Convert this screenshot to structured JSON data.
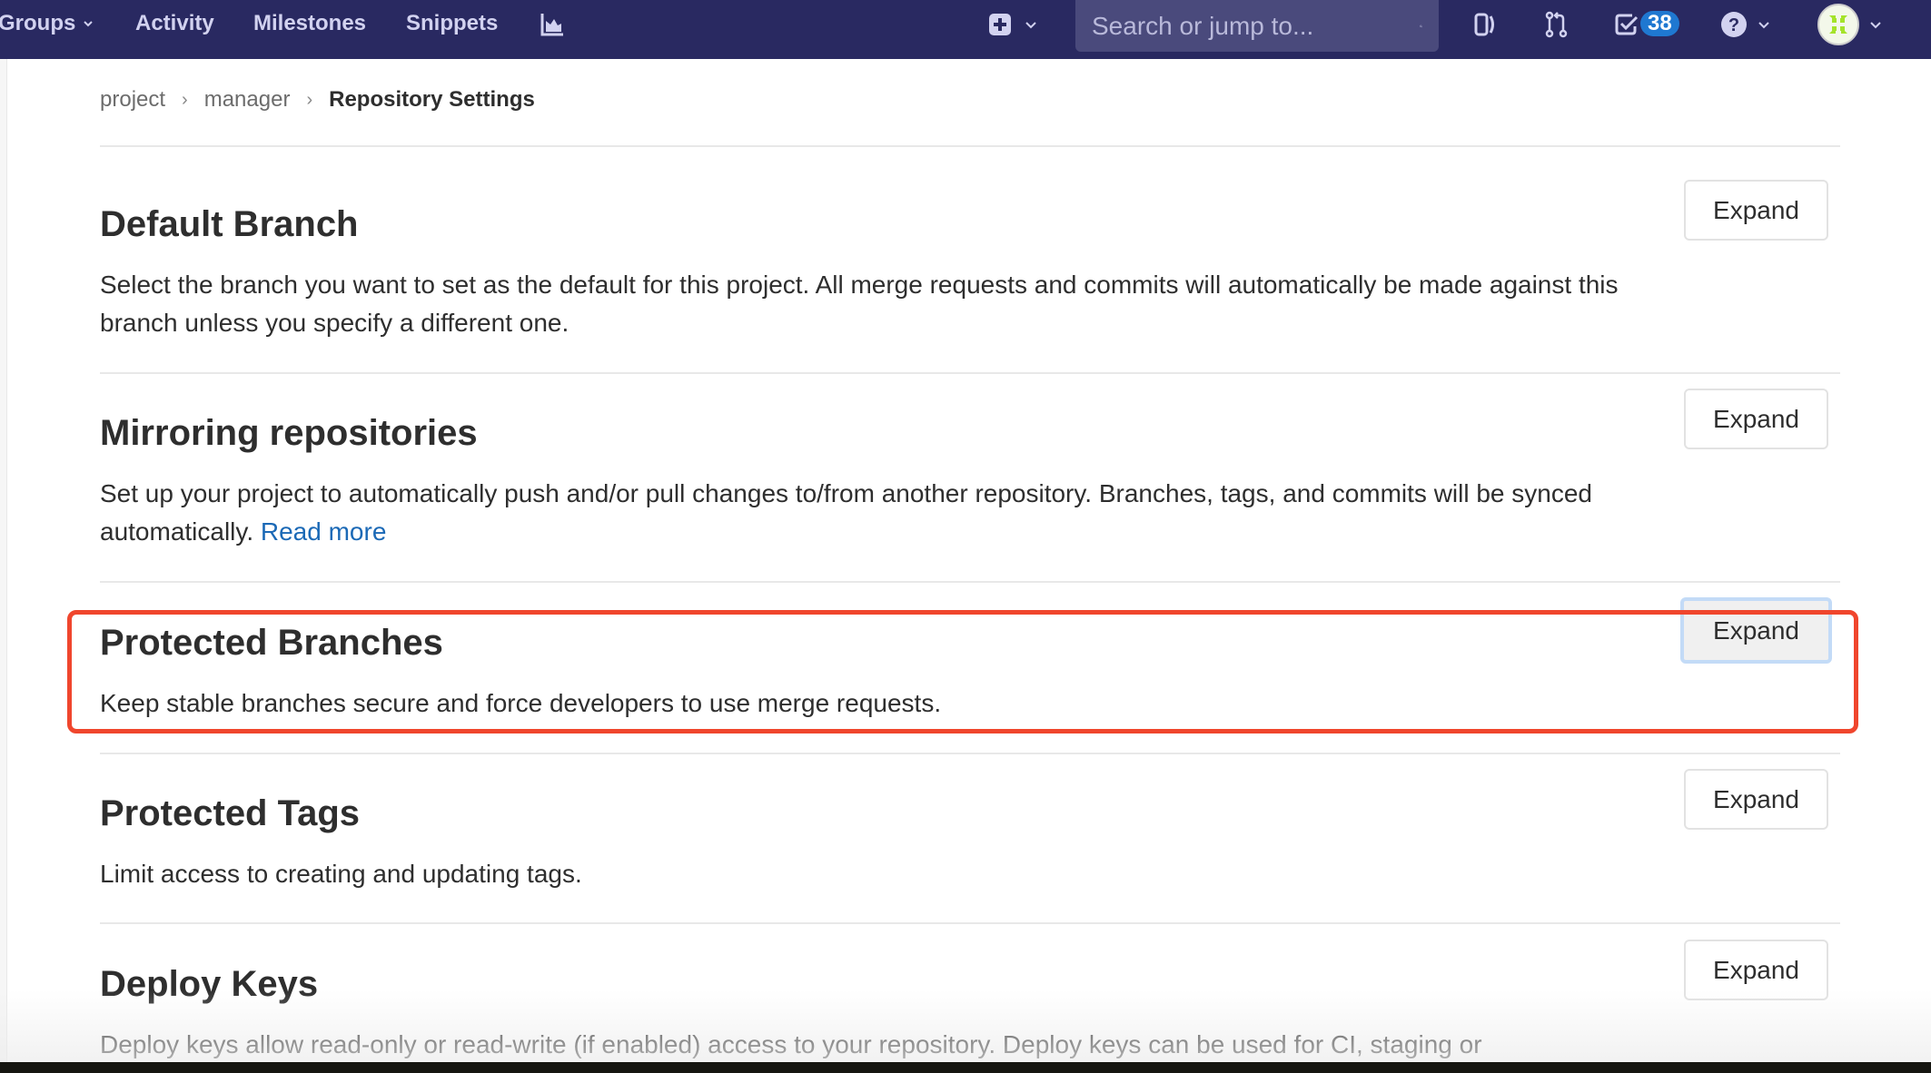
{
  "navbar": {
    "links": [
      {
        "label": "Groups",
        "has_dropdown": true
      },
      {
        "label": "Activity"
      },
      {
        "label": "Milestones"
      },
      {
        "label": "Snippets"
      }
    ],
    "chart_icon": "chart-icon",
    "new_icon": "plus-square-icon",
    "search": {
      "placeholder": "Search or jump to...",
      "value": ""
    },
    "issues_icon": "issues-icon",
    "merge_requests_icon": "merge-request-icon",
    "todos": {
      "icon": "todo-check-icon",
      "count": "38"
    },
    "help_icon": "help-icon",
    "avatar_icon": "user-avatar"
  },
  "breadcrumb": {
    "items": [
      "project",
      "manager"
    ],
    "current": "Repository Settings",
    "separator": "›"
  },
  "sections": [
    {
      "title": "Default Branch",
      "description": "Select the branch you want to set as the default for this project. All merge requests and commits will automatically be made against this branch unless you specify a different one.",
      "button": "Expand"
    },
    {
      "title": "Mirroring repositories",
      "description": "Set up your project to automatically push and/or pull changes to/from another repository. Branches, tags, and commits will be synced automatically.",
      "link": "Read more",
      "button": "Expand"
    },
    {
      "title": "Protected Branches",
      "description": "Keep stable branches secure and force developers to use merge requests.",
      "button": "Expand",
      "highlighted": true,
      "highlight_color": "#f0462d"
    },
    {
      "title": "Protected Tags",
      "description": "Limit access to creating and updating tags.",
      "button": "Expand"
    },
    {
      "title": "Deploy Keys",
      "description": "Deploy keys allow read-only or read-write (if enabled) access to your repository. Deploy keys can be used for CI, staging or",
      "button": "Expand"
    }
  ],
  "colors": {
    "navbar_bg": "#292961",
    "nav_text": "#d2d2f0",
    "link": "#1b69b6",
    "badge": "#1f78d1",
    "highlight": "#f0462d"
  }
}
